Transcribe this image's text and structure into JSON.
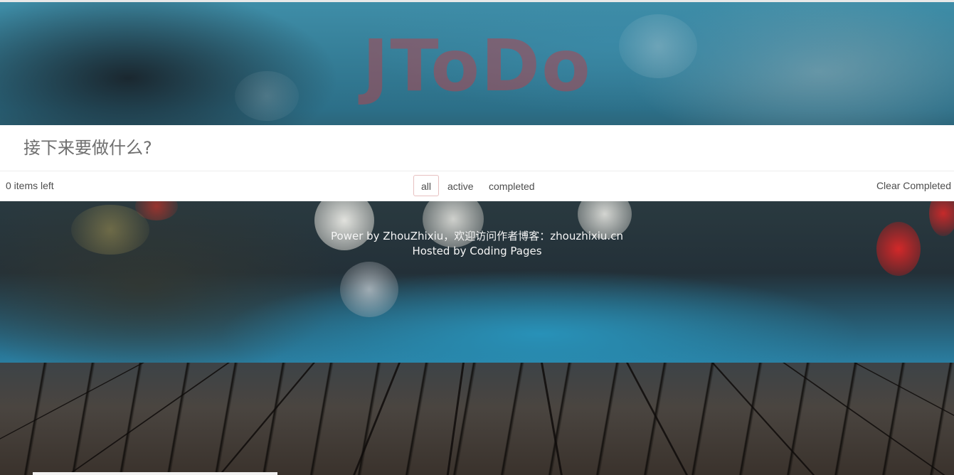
{
  "header": {
    "title": "JToDo"
  },
  "todo": {
    "input_placeholder": "接下来要做什么?",
    "input_value": ""
  },
  "footer_bar": {
    "items_left": "0 items left",
    "filters": [
      {
        "label": "all",
        "selected": true
      },
      {
        "label": "active",
        "selected": false
      },
      {
        "label": "completed",
        "selected": false
      }
    ],
    "clear_completed": "Clear Completed"
  },
  "credits": {
    "line1": "Power by ZhouZhixiu，欢迎访问作者博客：zhouzhixiu.cn",
    "line2": "Hosted by Coding Pages"
  },
  "colors": {
    "title": "#af4650",
    "selected_filter_border": "#af2f2f",
    "panel_background": "#ffffff",
    "credits_text": "#f5f5f5"
  }
}
